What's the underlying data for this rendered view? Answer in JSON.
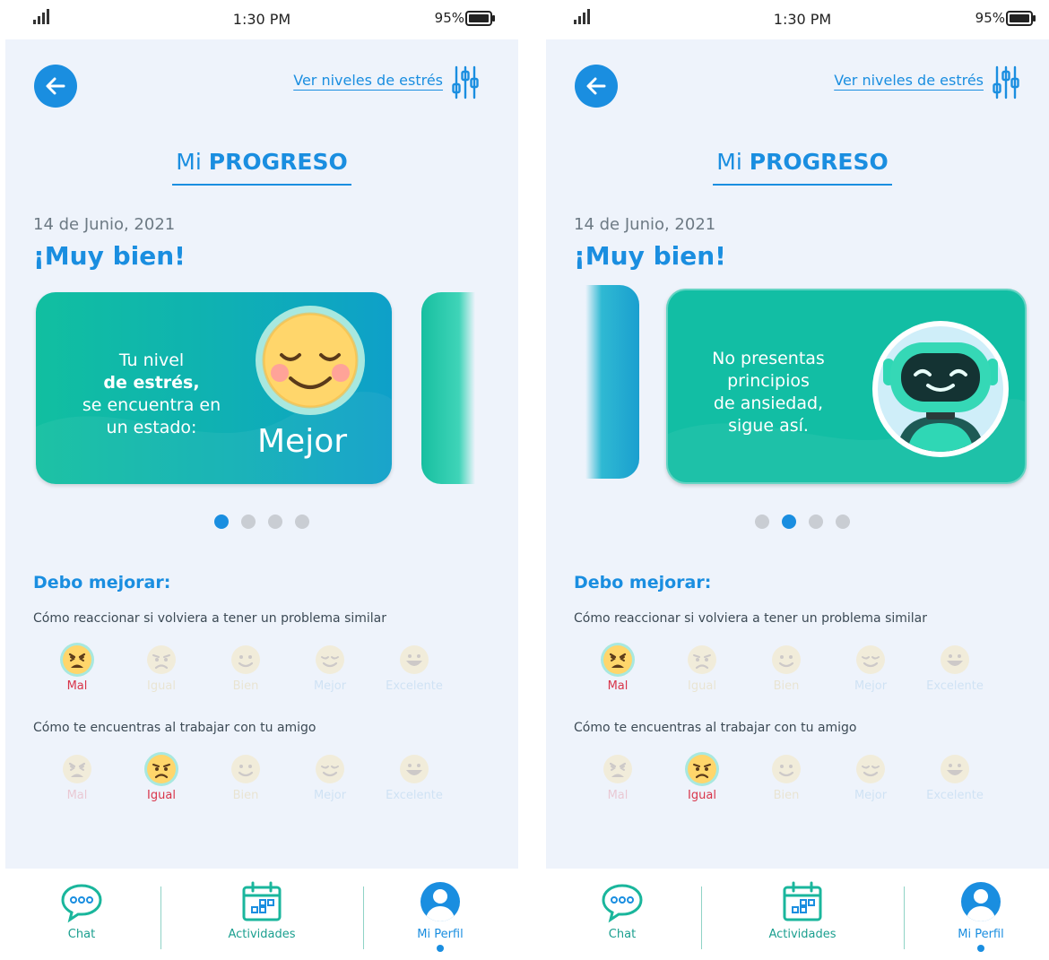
{
  "colors": {
    "accent": "#1a8ee0",
    "card_teal": "#12bea4",
    "card_blue": "#0ea0c9",
    "background": "#eef3fb",
    "mal_red": "#d8354a",
    "igual_yellow": "#d8b145",
    "emoji_face": "#ffd66b",
    "nav_teal": "#1a9f8f"
  },
  "status_bar": {
    "time": "1:30 PM",
    "battery": "95%",
    "signal_icon": "signal-icon",
    "battery_icon": "battery-icon"
  },
  "header": {
    "back_icon": "arrow-left-icon",
    "stress_link": "Ver niveles de estrés",
    "stress_link_icon": "sliders-icon",
    "title_light": "Mi",
    "title_bold": "PROGRESO"
  },
  "date": "14 de Junio, 2021",
  "headline": "¡Muy bien!",
  "screens": [
    {
      "card": {
        "line1": "Tu nivel",
        "line2_bold": "de estrés,",
        "line3": "se encuentra en",
        "line4": "un estado:",
        "level": "Mejor",
        "icon": "smiling-emoji-icon"
      },
      "active_dot": 1
    },
    {
      "card": {
        "line1": "No presentas",
        "line2": "principios",
        "line3": "de ansiedad,",
        "line4": "sigue así.",
        "icon": "robot-icon"
      },
      "active_dot": 2
    }
  ],
  "carousel": {
    "total_dots": 4
  },
  "improve": {
    "title": "Debo mejorar:",
    "questions": [
      {
        "text": "Cómo reaccionar si volviera a tener un problema similar",
        "selected": "Mal"
      },
      {
        "text": "Cómo te encuentras al trabajar con tu amigo",
        "selected": "Igual"
      }
    ],
    "moods": [
      "Mal",
      "Igual",
      "Bien",
      "Mejor",
      "Excelente"
    ]
  },
  "bottom_nav": [
    {
      "label": "Chat",
      "icon": "chat-bubble-icon"
    },
    {
      "label": "Actividades",
      "icon": "calendar-icon"
    },
    {
      "label": "Mi Perfil",
      "icon": "profile-icon",
      "active": true
    }
  ]
}
